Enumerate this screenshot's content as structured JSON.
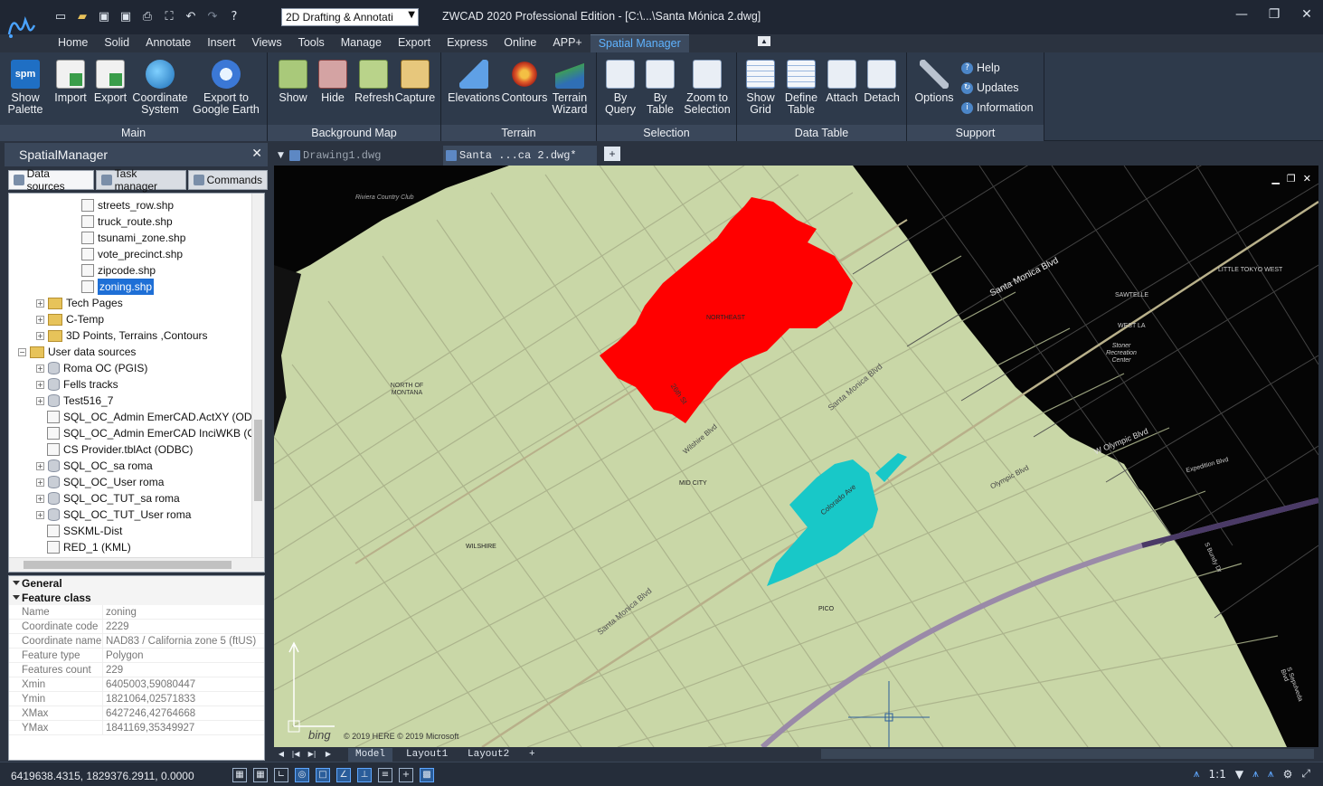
{
  "titlebar": {
    "workspace": "2D Drafting & Annotati",
    "title": "ZWCAD 2020 Professional Edition - [C:\\...\\Santa Mónica 2.dwg]",
    "qat_icons": [
      "new-file-icon",
      "open-folder-icon",
      "save-icon",
      "save-as-icon",
      "print-icon",
      "zoom-extents-icon",
      "undo-icon",
      "redo-icon",
      "help-icon"
    ]
  },
  "ribbon_tabs": [
    "Home",
    "Solid",
    "Annotate",
    "Insert",
    "Views",
    "Tools",
    "Manage",
    "Export",
    "Express",
    "Online",
    "APP+",
    "Spatial Manager"
  ],
  "ribbon": {
    "main": {
      "title": "Main",
      "show_palette": "Show Palette",
      "import": "Import",
      "export": "Export",
      "coordinate_system": "Coordinate System",
      "export_google_earth": "Export to Google Earth"
    },
    "background_map": {
      "title": "Background Map",
      "show": "Show",
      "hide": "Hide",
      "refresh": "Refresh",
      "capture": "Capture"
    },
    "terrain": {
      "title": "Terrain",
      "elevations": "Elevations",
      "contours": "Contours",
      "terrain_wizard": "Terrain Wizard"
    },
    "selection": {
      "title": "Selection",
      "by_query": "By Query",
      "by_table": "By Table",
      "zoom_to_selection": "Zoom to Selection"
    },
    "data_table": {
      "title": "Data Table",
      "show_grid": "Show Grid",
      "define_table": "Define Table",
      "attach": "Attach",
      "detach": "Detach"
    },
    "support": {
      "title": "Support",
      "options": "Options",
      "help": "Help",
      "updates": "Updates",
      "information": "Information"
    }
  },
  "palette": {
    "title": "SpatialManager",
    "tabs": [
      "Data sources",
      "Task manager",
      "Commands"
    ],
    "tree": [
      {
        "label": "streets_row.shp",
        "kind": "file"
      },
      {
        "label": "truck_route.shp",
        "kind": "file"
      },
      {
        "label": "tsunami_zone.shp",
        "kind": "file"
      },
      {
        "label": "vote_precinct.shp",
        "kind": "file"
      },
      {
        "label": "zipcode.shp",
        "kind": "file"
      },
      {
        "label": "zoning.shp",
        "kind": "file-selected"
      },
      {
        "label": "Tech Pages",
        "kind": "folder"
      },
      {
        "label": "C-Temp",
        "kind": "folder"
      },
      {
        "label": "3D Points, Terrains ,Contours",
        "kind": "folder"
      },
      {
        "label": "User data sources",
        "kind": "root"
      },
      {
        "label": "Roma OC (PGIS)",
        "kind": "db"
      },
      {
        "label": "Fells tracks",
        "kind": "db"
      },
      {
        "label": "Test516_7",
        "kind": "db"
      },
      {
        "label": "SQL_OC_Admin EmerCAD.ActXY (ODE",
        "kind": "table"
      },
      {
        "label": "SQL_OC_Admin EmerCAD InciWKB (O",
        "kind": "table"
      },
      {
        "label": "CS Provider.tblAct (ODBC)",
        "kind": "table"
      },
      {
        "label": "SQL_OC_sa roma",
        "kind": "db"
      },
      {
        "label": "SQL_OC_User roma",
        "kind": "db"
      },
      {
        "label": "SQL_OC_TUT_sa roma",
        "kind": "db"
      },
      {
        "label": "SQL_OC_TUT_User roma",
        "kind": "db"
      },
      {
        "label": "SSKML-Dist",
        "kind": "table"
      },
      {
        "label": "RED_1 (KML)",
        "kind": "table"
      }
    ],
    "properties": {
      "general_label": "General",
      "feature_class_label": "Feature class",
      "rows": [
        {
          "key": "Name",
          "value": "zoning"
        },
        {
          "key": "Coordinate code",
          "value": "2229"
        },
        {
          "key": "Coordinate name",
          "value": "NAD83 / California zone 5 (ftUS)"
        },
        {
          "key": "Feature type",
          "value": "Polygon"
        },
        {
          "key": "Features count",
          "value": "229"
        },
        {
          "key": "Xmin",
          "value": "6405003,59080447"
        },
        {
          "key": "Ymin",
          "value": "1821064,02571833"
        },
        {
          "key": "XMax",
          "value": "6427246,42764668"
        },
        {
          "key": "YMax",
          "value": "1841169,35349927"
        }
      ]
    }
  },
  "documents": {
    "tabs": [
      "Drawing1.dwg",
      "Santa ...ca 2.dwg*"
    ]
  },
  "map": {
    "labels": {
      "santa_monica_blvd": "Santa Monica Blvd",
      "wilshire": "WILSHIRE",
      "mid_city": "MID CITY",
      "northeast": "NORTHEAST",
      "north_of_montana": "NORTH OF MONTANA",
      "sawtelle": "SAWTELLE",
      "west_la": "WEST LA",
      "little_tokyo_west": "LITTLE TOKYO WEST",
      "olympic_blvd": "Olympic Blvd",
      "w_olympic_blvd": "W Olympic Blvd",
      "pico": "PICO",
      "riviera": "Riviera Country Club",
      "stoner": "Stoner Recreation Center",
      "colorado_ave": "Colorado Ave",
      "wilshire_blvd": "Wilshire Blvd",
      "26th_st": "26th St",
      "expo": "Expedition Blvd",
      "bundy": "S Bundy Dr",
      "sepulveda": "S Sepulveda Blvd"
    },
    "bing": "bing",
    "copyright": "© 2019 HERE © 2019 Microsoft",
    "colors": {
      "land": "#c9d7a7",
      "dark": "#050505",
      "zone_red": "#ff0000",
      "zone_cyan": "#18c8c8"
    }
  },
  "layout_tabs": [
    "Model",
    "Layout1",
    "Layout2",
    "+"
  ],
  "status": {
    "coords": "6419638.4315, 1829376.2911, 0.0000",
    "scale": "1:1"
  }
}
